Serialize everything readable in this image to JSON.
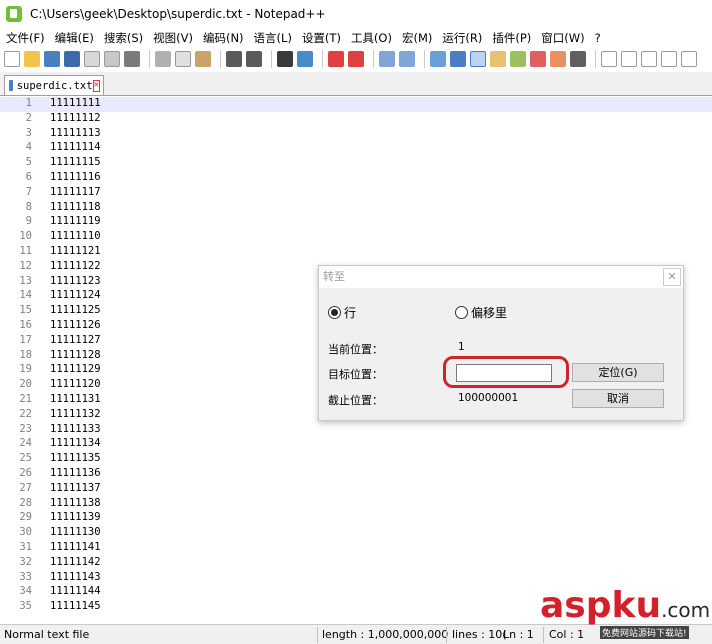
{
  "window": {
    "title": "C:\\Users\\geek\\Desktop\\superdic.txt - Notepad++"
  },
  "menu": [
    "文件(F)",
    "编辑(E)",
    "搜索(S)",
    "视图(V)",
    "编码(N)",
    "语言(L)",
    "设置(T)",
    "工具(O)",
    "宏(M)",
    "运行(R)",
    "插件(P)",
    "窗口(W)",
    "?"
  ],
  "tab": {
    "label": "superdic.txt",
    "close": "✕"
  },
  "editor": {
    "lines": [
      {
        "n": "1",
        "t": "11111111"
      },
      {
        "n": "2",
        "t": "11111112"
      },
      {
        "n": "3",
        "t": "11111113"
      },
      {
        "n": "4",
        "t": "11111114"
      },
      {
        "n": "5",
        "t": "11111115"
      },
      {
        "n": "6",
        "t": "11111116"
      },
      {
        "n": "7",
        "t": "11111117"
      },
      {
        "n": "8",
        "t": "11111118"
      },
      {
        "n": "9",
        "t": "11111119"
      },
      {
        "n": "10",
        "t": "11111110"
      },
      {
        "n": "11",
        "t": "11111121"
      },
      {
        "n": "12",
        "t": "11111122"
      },
      {
        "n": "13",
        "t": "11111123"
      },
      {
        "n": "14",
        "t": "11111124"
      },
      {
        "n": "15",
        "t": "11111125"
      },
      {
        "n": "16",
        "t": "11111126"
      },
      {
        "n": "17",
        "t": "11111127"
      },
      {
        "n": "18",
        "t": "11111128"
      },
      {
        "n": "19",
        "t": "11111129"
      },
      {
        "n": "20",
        "t": "11111120"
      },
      {
        "n": "21",
        "t": "11111131"
      },
      {
        "n": "22",
        "t": "11111132"
      },
      {
        "n": "23",
        "t": "11111133"
      },
      {
        "n": "24",
        "t": "11111134"
      },
      {
        "n": "25",
        "t": "11111135"
      },
      {
        "n": "26",
        "t": "11111136"
      },
      {
        "n": "27",
        "t": "11111137"
      },
      {
        "n": "28",
        "t": "11111138"
      },
      {
        "n": "29",
        "t": "11111139"
      },
      {
        "n": "30",
        "t": "11111130"
      },
      {
        "n": "31",
        "t": "11111141"
      },
      {
        "n": "32",
        "t": "11111142"
      },
      {
        "n": "33",
        "t": "11111143"
      },
      {
        "n": "34",
        "t": "11111144"
      },
      {
        "n": "35",
        "t": "11111145"
      }
    ]
  },
  "goto_dialog": {
    "title": "转至",
    "close": "✕",
    "radio_line": "行",
    "radio_offset": "偏移里",
    "current_label": "当前位置：",
    "current_value": "1",
    "target_label": "目标位置：",
    "target_value": "",
    "end_label": "截止位置：",
    "end_value": "100000001",
    "go_button": "定位(G)",
    "cancel_button": "取消"
  },
  "status": {
    "type": "Normal text file",
    "length": "length : 1,000,000,000",
    "lines": "lines : 10(",
    "ln": "Ln : 1",
    "col": "Col : 1"
  },
  "watermark": {
    "logo_a": "asp",
    "logo_b": "ku",
    "logo_c": ".com",
    "sub": "免费网站源码下载站!"
  }
}
